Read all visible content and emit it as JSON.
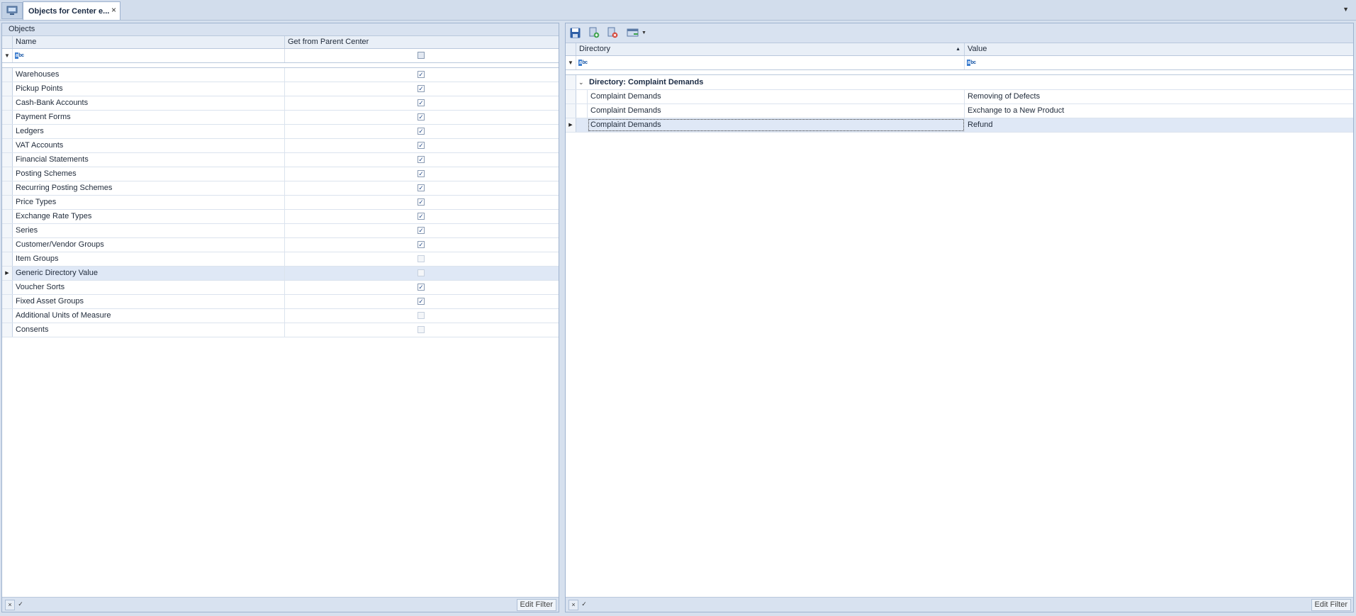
{
  "tab": {
    "title": "Objects for Center e...",
    "close_icon": "×"
  },
  "left": {
    "caption": "Objects",
    "columns": {
      "name": "Name",
      "get_from_parent": "Get from Parent Center"
    },
    "rows": [
      {
        "name": "Warehouses",
        "checked": true
      },
      {
        "name": "Pickup Points",
        "checked": true
      },
      {
        "name": "Cash-Bank Accounts",
        "checked": true
      },
      {
        "name": "Payment Forms",
        "checked": true
      },
      {
        "name": "Ledgers",
        "checked": true
      },
      {
        "name": "VAT Accounts",
        "checked": true
      },
      {
        "name": "Financial Statements",
        "checked": true
      },
      {
        "name": "Posting Schemes",
        "checked": true
      },
      {
        "name": "Recurring Posting Schemes",
        "checked": true
      },
      {
        "name": "Price Types",
        "checked": true
      },
      {
        "name": "Exchange Rate Types",
        "checked": true
      },
      {
        "name": "Series",
        "checked": true
      },
      {
        "name": "Customer/Vendor Groups",
        "checked": true
      },
      {
        "name": "Item Groups",
        "checked": false
      },
      {
        "name": "Generic Directory Value",
        "checked": false,
        "selected": true
      },
      {
        "name": "Voucher Sorts",
        "checked": true
      },
      {
        "name": "Fixed Asset Groups",
        "checked": true
      },
      {
        "name": "Additional Units of Measure",
        "checked": false
      },
      {
        "name": "Consents",
        "checked": false
      }
    ],
    "footer": {
      "edit_filter": "Edit Filter"
    }
  },
  "right": {
    "columns": {
      "directory": "Directory",
      "value": "Value"
    },
    "group_label": "Directory: Complaint Demands",
    "rows": [
      {
        "directory": "Complaint Demands",
        "value": "Removing of Defects"
      },
      {
        "directory": "Complaint Demands",
        "value": "Exchange to a New Product"
      },
      {
        "directory": "Complaint Demands",
        "value": "Refund",
        "selected": true
      }
    ],
    "footer": {
      "edit_filter": "Edit Filter"
    }
  },
  "colors": {
    "accent": "#3f7fd0",
    "selection": "#dfe8f6",
    "panel_bg": "#d8e2f0"
  }
}
